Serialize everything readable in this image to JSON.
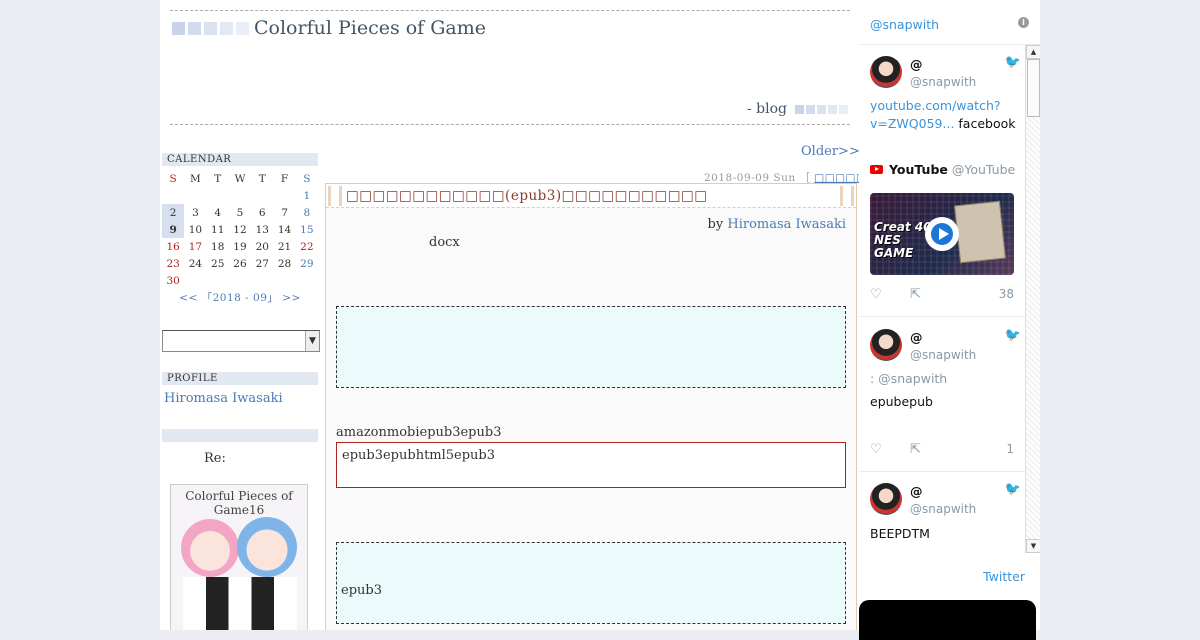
{
  "header": {
    "title": "Colorful Pieces of Game",
    "subtitle": "- blog",
    "squares": [
      "#c8d4ea",
      "#d2dcee",
      "#dae2f1",
      "#e2e8f4",
      "#eaeff7"
    ]
  },
  "calendar": {
    "title": "CALENDAR",
    "days": [
      "S",
      "M",
      "T",
      "W",
      "T",
      "F",
      "S"
    ],
    "weeks": [
      [
        "",
        "",
        "",
        "",
        "",
        "",
        "1"
      ],
      [
        "2",
        "3",
        "4",
        "5",
        "6",
        "7",
        "8"
      ],
      [
        "9",
        "10",
        "11",
        "12",
        "13",
        "14",
        "15"
      ],
      [
        "16",
        "17",
        "18",
        "19",
        "20",
        "21",
        "22"
      ],
      [
        "23",
        "24",
        "25",
        "26",
        "27",
        "28",
        "29"
      ],
      [
        "30",
        "",
        "",
        "",
        "",
        "",
        ""
      ]
    ],
    "nav": "<< 「2018 - 09」 >>"
  },
  "profile": {
    "title": "PROFILE",
    "name": "Hiromasa Iwasaki"
  },
  "sidebar_extra": {
    "re": "Re:",
    "book_title": "Colorful Pieces of Game16"
  },
  "main": {
    "older": "Older>>",
    "date": "2018-09-09 Sun ",
    "date_bracket": "［",
    "category": "□□□□□",
    "article_title": "□□□□□□□□□□□□(epub3)□□□□□□□□□□□",
    "by": "by ",
    "author": "Hiromasa Iwasaki",
    "docx": "docx",
    "para2": "amazonmobiepub3epub3",
    "redbox": "epub3epubhtml5epub3",
    "note2": "epub3"
  },
  "twitter": {
    "handle": "@snapwith",
    "tweets": [
      {
        "name": "@",
        "handle": "@snapwith",
        "link": "youtube.com/watch?v=ZWQ059...",
        "text_after": " facebook",
        "card_channel": "YouTube",
        "card_handle": "@YouTube",
        "video_text": "Creat 40 NES GAME",
        "likes": "38"
      },
      {
        "name": "@",
        "handle": "@snapwith",
        "reply": ": @snapwith",
        "text": "epubepub",
        "likes": "1"
      },
      {
        "name": "@",
        "handle": "@snapwith",
        "text": "BEEPDTM"
      }
    ],
    "footer_link": "Twitter"
  }
}
